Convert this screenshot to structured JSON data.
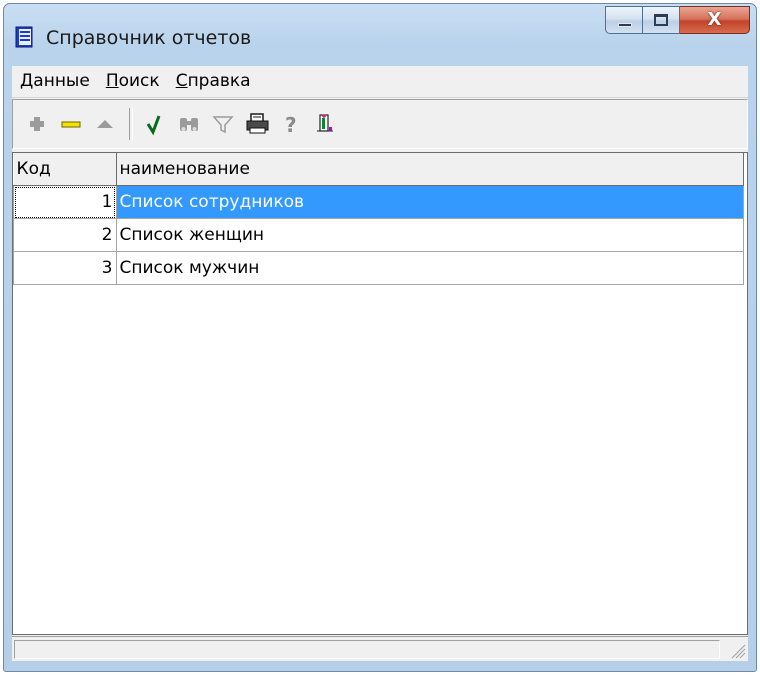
{
  "window": {
    "title": "Справочник отчетов",
    "icon": "notebook-icon",
    "controls": {
      "minimize": "minimize-icon",
      "maximize": "maximize-icon",
      "close_glyph": "X"
    }
  },
  "menu": {
    "items": [
      {
        "accel": "Д",
        "rest": "анные"
      },
      {
        "accel": "П",
        "rest": "оиск"
      },
      {
        "accel": "С",
        "rest": "правка"
      }
    ]
  },
  "toolbar": {
    "buttons": [
      "add-icon",
      "delete-icon",
      "move-up-icon",
      "check-icon",
      "binoculars-icon",
      "filter-icon",
      "printer-icon",
      "help-icon",
      "exit-door-icon"
    ]
  },
  "grid": {
    "columns": [
      "Код",
      "наименование"
    ],
    "rows": [
      {
        "code": "1",
        "name": "Список сотрудников",
        "selected": true
      },
      {
        "code": "2",
        "name": "Список женщин",
        "selected": false
      },
      {
        "code": "3",
        "name": "Список мужчин",
        "selected": false
      }
    ]
  },
  "colors": {
    "selection": "#3399ff",
    "frame": "#b9d1ea",
    "close_button": "#c9482e"
  }
}
